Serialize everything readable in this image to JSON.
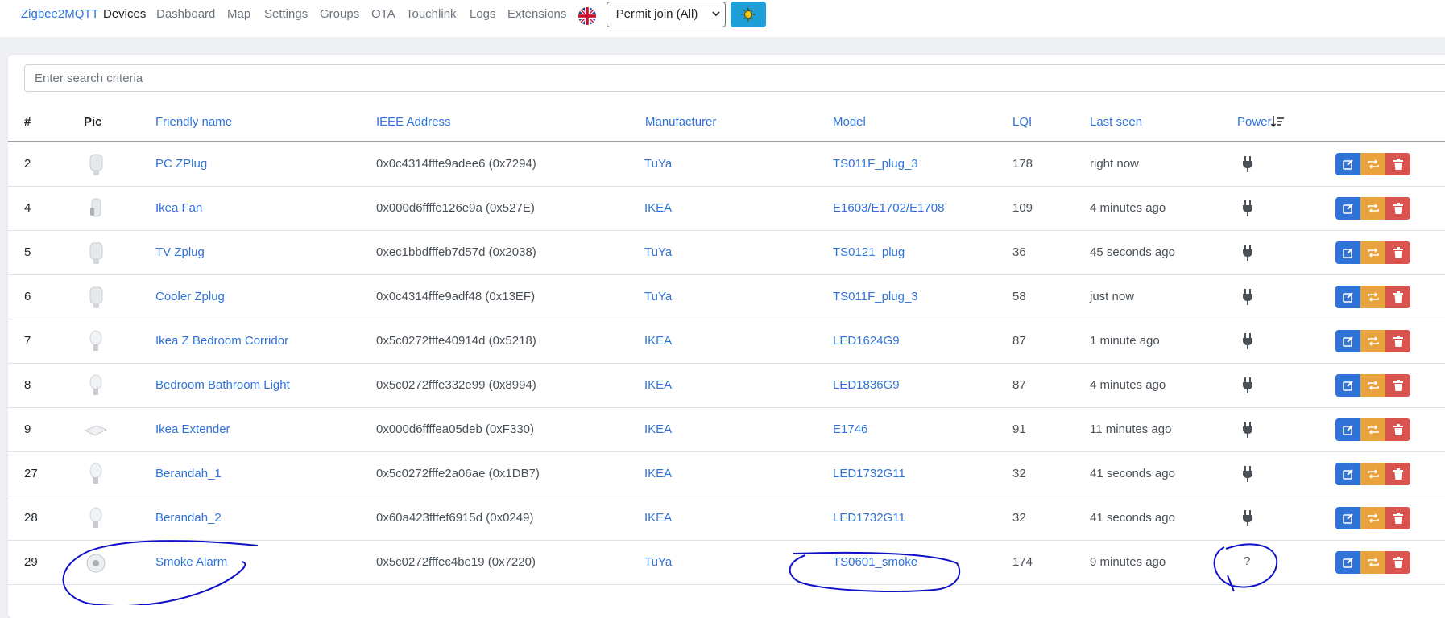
{
  "nav": {
    "brand": "Zigbee2MQTT",
    "links": [
      "Devices",
      "Dashboard",
      "Map",
      "Settings",
      "Groups",
      "OTA",
      "Touchlink",
      "Logs",
      "Extensions"
    ],
    "permit_join_label": "Permit join (All)"
  },
  "search": {
    "placeholder": "Enter search criteria"
  },
  "table": {
    "headers": {
      "index": "#",
      "pic": "Pic",
      "friendly_name": "Friendly name",
      "ieee": "IEEE Address",
      "manufacturer": "Manufacturer",
      "model": "Model",
      "lqi": "LQI",
      "last_seen": "Last seen",
      "power": "Power"
    },
    "rows": [
      {
        "index": "2",
        "name": "PC ZPlug",
        "ieee": "0x0c4314fffe9adee6 (0x7294)",
        "manufacturer": "TuYa",
        "model": "TS011F_plug_3",
        "lqi": "178",
        "last_seen": "right now",
        "power": "plug",
        "pic": "plug"
      },
      {
        "index": "4",
        "name": "Ikea Fan",
        "ieee": "0x000d6ffffe126e9a (0x527E)",
        "manufacturer": "IKEA",
        "model": "E1603/E1702/E1708",
        "lqi": "109",
        "last_seen": "4 minutes ago",
        "power": "plug",
        "pic": "plug-side"
      },
      {
        "index": "5",
        "name": "TV Zplug",
        "ieee": "0xec1bbdfffeb7d57d (0x2038)",
        "manufacturer": "TuYa",
        "model": "TS0121_plug",
        "lqi": "36",
        "last_seen": "45 seconds ago",
        "power": "plug",
        "pic": "plug"
      },
      {
        "index": "6",
        "name": "Cooler Zplug",
        "ieee": "0x0c4314fffe9adf48 (0x13EF)",
        "manufacturer": "TuYa",
        "model": "TS011F_plug_3",
        "lqi": "58",
        "last_seen": "just now",
        "power": "plug",
        "pic": "plug"
      },
      {
        "index": "7",
        "name": "Ikea Z Bedroom Corridor",
        "ieee": "0x5c0272fffe40914d (0x5218)",
        "manufacturer": "IKEA",
        "model": "LED1624G9",
        "lqi": "87",
        "last_seen": "1 minute ago",
        "power": "plug",
        "pic": "bulb"
      },
      {
        "index": "8",
        "name": "Bedroom Bathroom Light",
        "ieee": "0x5c0272fffe332e99 (0x8994)",
        "manufacturer": "IKEA",
        "model": "LED1836G9",
        "lqi": "87",
        "last_seen": "4 minutes ago",
        "power": "plug",
        "pic": "bulb"
      },
      {
        "index": "9",
        "name": "Ikea Extender",
        "ieee": "0x000d6ffffea05deb (0xF330)",
        "manufacturer": "IKEA",
        "model": "E1746",
        "lqi": "91",
        "last_seen": "11 minutes ago",
        "power": "plug",
        "pic": "extender"
      },
      {
        "index": "27",
        "name": "Berandah_1",
        "ieee": "0x5c0272fffe2a06ae (0x1DB7)",
        "manufacturer": "IKEA",
        "model": "LED1732G11",
        "lqi": "32",
        "last_seen": "41 seconds ago",
        "power": "plug",
        "pic": "bulb"
      },
      {
        "index": "28",
        "name": "Berandah_2",
        "ieee": "0x60a423fffef6915d (0x0249)",
        "manufacturer": "IKEA",
        "model": "LED1732G11",
        "lqi": "32",
        "last_seen": "41 seconds ago",
        "power": "plug",
        "pic": "bulb"
      },
      {
        "index": "29",
        "name": "Smoke Alarm",
        "ieee": "0x5c0272fffec4be19 (0x7220)",
        "manufacturer": "TuYa",
        "model": "TS0601_smoke",
        "lqi": "174",
        "last_seen": "9 minutes ago",
        "power": "unknown",
        "power_text": "?",
        "pic": "smoke"
      }
    ]
  },
  "colors": {
    "link": "#2f73d8",
    "edit": "#2f73d8",
    "rename": "#e8a33d",
    "remove": "#d9534f",
    "annotation": "#1010c8"
  }
}
